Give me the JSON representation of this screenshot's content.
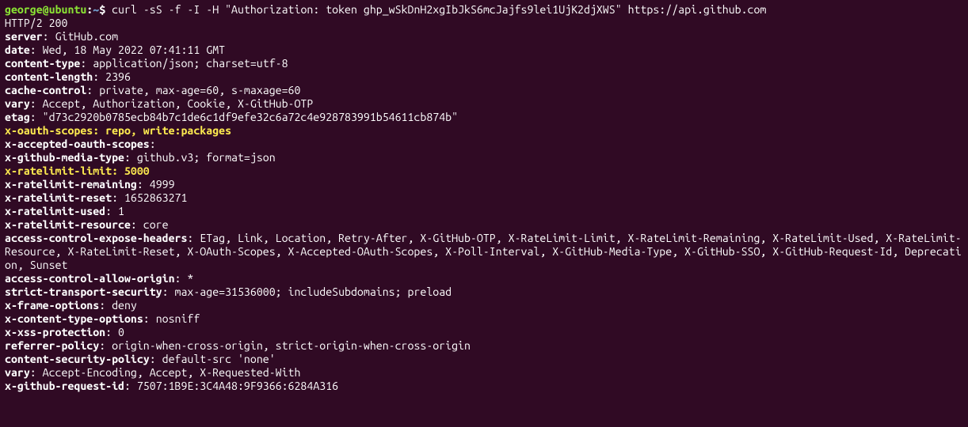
{
  "prompt": {
    "user_host": "george@ubuntu",
    "colon": ":",
    "path": "~",
    "sigil": "$ "
  },
  "command": "curl -sS -f -I -H \"Authorization: token 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\" https://api.github.com",
  "status_line": "HTTP/2 200",
  "headers": [
    {
      "key_bold": true,
      "highlight": false,
      "key": "server",
      "sep": ": ",
      "value": "GitHub.com"
    },
    {
      "key_bold": true,
      "highlight": false,
      "key": "date",
      "sep": ": ",
      "value": "Wed, 18 May 2022 07:41:11 GMT"
    },
    {
      "key_bold": true,
      "highlight": false,
      "key": "content-type",
      "sep": ": ",
      "value": "application/json; charset=utf-8"
    },
    {
      "key_bold": true,
      "highlight": false,
      "key": "content-length",
      "sep": ": ",
      "value": "2396"
    },
    {
      "key_bold": true,
      "highlight": false,
      "key": "cache-control",
      "sep": ": ",
      "value": "private, max-age=60, s-maxage=60"
    },
    {
      "key_bold": true,
      "highlight": false,
      "key": "vary",
      "sep": ": ",
      "value": "Accept, Authorization, Cookie, X-GitHub-OTP"
    },
    {
      "key_bold": true,
      "highlight": false,
      "key": "etag",
      "sep": ": ",
      "value": "\"d73c2920b0785ecb84b7c1de6c1df9efe32c6a72c4e928783991b54611cb874b\""
    },
    {
      "key_bold": true,
      "highlight": true,
      "key": "x-oauth-scopes",
      "sep": ": ",
      "value": "repo, write:packages"
    },
    {
      "key_bold": true,
      "highlight": false,
      "key": "x-accepted-oauth-scopes",
      "sep": ": ",
      "value": ""
    },
    {
      "key_bold": true,
      "highlight": false,
      "key": "x-github-media-type",
      "sep": ": ",
      "value": "github.v3; format=json"
    },
    {
      "key_bold": true,
      "highlight": true,
      "key": "x-ratelimit-limit",
      "sep": ": ",
      "value": "5000"
    },
    {
      "key_bold": true,
      "highlight": false,
      "key": "x-ratelimit-remaining",
      "sep": ": ",
      "value": "4999"
    },
    {
      "key_bold": true,
      "highlight": false,
      "key": "x-ratelimit-reset",
      "sep": ": ",
      "value": "1652863271"
    },
    {
      "key_bold": true,
      "highlight": false,
      "key": "x-ratelimit-used",
      "sep": ": ",
      "value": "1"
    },
    {
      "key_bold": true,
      "highlight": false,
      "key": "x-ratelimit-resource",
      "sep": ": ",
      "value": "core"
    },
    {
      "key_bold": true,
      "highlight": false,
      "key": "access-control-expose-headers",
      "sep": ": ",
      "value": "ETag, Link, Location, Retry-After, X-GitHub-OTP, X-RateLimit-Limit, X-RateLimit-Remaining, X-RateLimit-Used, X-RateLimit-Resource, X-RateLimit-Reset, X-OAuth-Scopes, X-Accepted-OAuth-Scopes, X-Poll-Interval, X-GitHub-Media-Type, X-GitHub-SSO, X-GitHub-Request-Id, Deprecation, Sunset"
    },
    {
      "key_bold": true,
      "highlight": false,
      "key": "access-control-allow-origin",
      "sep": ": ",
      "value": "*"
    },
    {
      "key_bold": true,
      "highlight": false,
      "key": "strict-transport-security",
      "sep": ": ",
      "value": "max-age=31536000; includeSubdomains; preload"
    },
    {
      "key_bold": true,
      "highlight": false,
      "key": "x-frame-options",
      "sep": ": ",
      "value": "deny"
    },
    {
      "key_bold": true,
      "highlight": false,
      "key": "x-content-type-options",
      "sep": ": ",
      "value": "nosniff"
    },
    {
      "key_bold": true,
      "highlight": false,
      "key": "x-xss-protection",
      "sep": ": ",
      "value": "0"
    },
    {
      "key_bold": true,
      "highlight": false,
      "key": "referrer-policy",
      "sep": ": ",
      "value": "origin-when-cross-origin, strict-origin-when-cross-origin"
    },
    {
      "key_bold": true,
      "highlight": false,
      "key": "content-security-policy",
      "sep": ": ",
      "value": "default-src 'none'"
    },
    {
      "key_bold": true,
      "highlight": false,
      "key": "vary",
      "sep": ": ",
      "value": "Accept-Encoding, Accept, X-Requested-With"
    },
    {
      "key_bold": true,
      "highlight": false,
      "key": "x-github-request-id",
      "sep": ": ",
      "value": "7507:1B9E:3C4A48:9F9366:6284A316"
    }
  ]
}
